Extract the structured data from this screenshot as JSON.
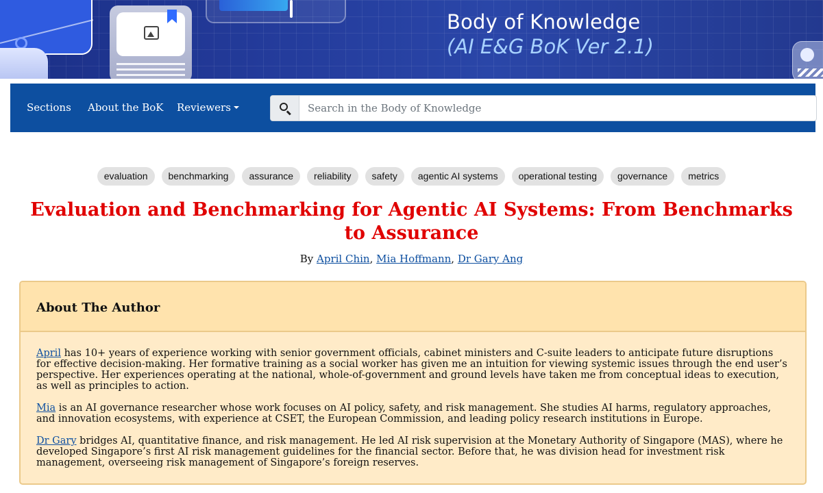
{
  "banner": {
    "title": "Body of Knowledge",
    "subtitle": "(AI E&G BoK Ver 2.1)"
  },
  "nav": {
    "items": [
      {
        "label": "Sections"
      },
      {
        "label": "About the BoK"
      },
      {
        "label": "Reviewers"
      }
    ],
    "search_placeholder": "Search in the Body of Knowledge"
  },
  "tags": [
    "evaluation",
    "benchmarking",
    "assurance",
    "reliability",
    "safety",
    "agentic AI systems",
    "operational testing",
    "governance",
    "metrics"
  ],
  "article": {
    "title": "Evaluation and Benchmarking for Agentic AI Systems: From Benchmarks to Assurance",
    "by_label": "By",
    "authors": [
      "April Chin",
      "Mia Hoffmann",
      "Dr Gary Ang"
    ]
  },
  "about": {
    "heading": "About The Author",
    "bios": [
      {
        "name": "April",
        "text": " has 10+ years of experience working with senior government officials, cabinet ministers and C-suite leaders to anticipate future disruptions for effective decision-making. Her formative training as a social worker has given me an intuition for viewing systemic issues through the end user’s perspective. Her experiences operating at the national, whole-of-government and ground levels have taken me from conceptual ideas to execution, as well as principles to action."
      },
      {
        "name": "Mia",
        "text": " is an AI governance researcher whose work focuses on AI policy, safety, and risk management. She studies AI harms, regulatory approaches, and innovation ecosystems, with experience at CSET, the European Commission, and leading policy research institutions in Europe."
      },
      {
        "name": "Dr Gary",
        "text": " bridges AI, quantitative finance, and risk management. He led AI risk supervision at the Monetary Authority of Singapore (MAS), where he developed Singapore’s first AI risk management guidelines for the financial sector. Before that, he was division head for investment risk management, overseeing risk management of Singapore’s foreign reserves."
      }
    ]
  },
  "colors": {
    "navbar": "#0d4fa0",
    "title": "#e00000",
    "link": "#0d4fa0",
    "card_bg": "#ffebc8",
    "card_header": "#ffe3ad"
  }
}
